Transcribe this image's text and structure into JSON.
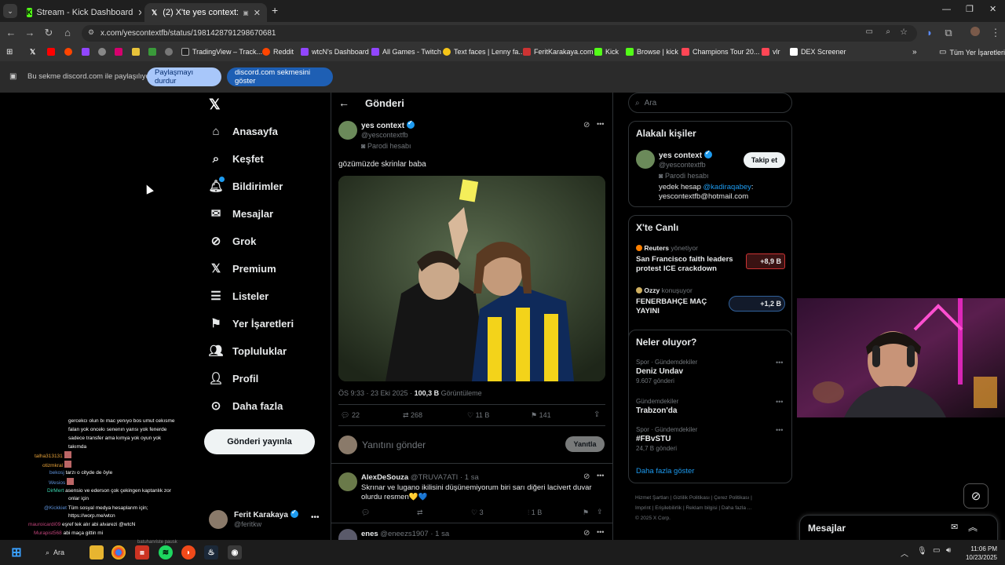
{
  "browser": {
    "tabs": [
      {
        "label": "Stream - Kick Dashboard",
        "icon": "kick-icon"
      },
      {
        "label": "(2) X'te yes context: \"gözüm",
        "icon": "x-icon"
      }
    ],
    "url": "x.com/yescontextfb/status/1981428791298670681",
    "bookmarks": [
      "TradingView – Track...",
      "Reddit",
      "wtcN's Dashboard",
      "All Games - Twitch",
      "Text faces | Lenny fa...",
      "FeritKarakaya.com",
      "Kick",
      "Browse | kick",
      "Champions Tour 20...",
      "vlr",
      "DEX Screener"
    ],
    "all_bookmarks": "Tüm Yer İşaretleri",
    "share": {
      "text": "Bu sekme discord.com ile paylaşılıyor",
      "stop": "Paylaşmayı durdur",
      "show": "discord.com sekmesini göster"
    }
  },
  "sidebar": {
    "items": [
      "Anasayfa",
      "Keşfet",
      "Bildirimler",
      "Mesajlar",
      "Grok",
      "Premium",
      "Listeler",
      "Yer İşaretleri",
      "Topluluklar",
      "Profil",
      "Daha fazla"
    ],
    "post_button": "Gönderi yayınla",
    "account": {
      "name": "Ferit Karakaya",
      "handle": "@feritkw"
    }
  },
  "main": {
    "header": "Gönderi",
    "post": {
      "author": "yes context",
      "handle": "@yescontextfb",
      "badge": "Parodi hesabı",
      "text": "gözümüzde skrinlar baba",
      "time": "ÖS 9:33 · 23 Eki 2025 ·",
      "views_count": "100,3 B",
      "views_label": "Görüntüleme",
      "stats": {
        "replies": "22",
        "reposts": "268",
        "likes": "11 B",
        "bookmarks": "141"
      }
    },
    "reply_placeholder": "Yanıtını gönder",
    "reply_button": "Yanıtla",
    "replies": [
      {
        "author": "AlexDeSouza",
        "handle": "@TRUVA7ATI",
        "time": "· 1 sa",
        "text": "Skrınar ve lugano ikilisini düşünemiyorum biri sarı diğeri lacivert duvar olurdu resmen💛💙",
        "likes": "3",
        "views": "1 B"
      },
      {
        "author": "enes",
        "handle": "@eneezs1907",
        "time": "· 1 sa"
      }
    ]
  },
  "right": {
    "search_placeholder": "Ara",
    "related": {
      "title": "Alakalı kişiler",
      "name": "yes context",
      "handle": "@yescontextfb",
      "badge": "Parodi hesabı",
      "follow": "Takip et",
      "bio_prefix": "yedek hesap",
      "bio_mention": "@kadiraqabey",
      "bio_suffix": ":",
      "bio_line2": "yescontextfb@hotmail.com"
    },
    "live": {
      "title": "X'te Canlı",
      "items": [
        {
          "host": "Reuters",
          "status": "yönetiyor",
          "title": "San Francisco faith leaders protest ICE crackdown",
          "count": "+8,9 B"
        },
        {
          "host": "Ozzy",
          "status": "konuşuyor",
          "title": "FENERBAHÇE MAÇ YAYINI",
          "count": "+1,2 B"
        }
      ]
    },
    "trends": {
      "title": "Neler oluyor?",
      "items": [
        {
          "category": "Spor · Gündemdekiler",
          "name": "Deniz Undav",
          "posts": "9.607 gönderi"
        },
        {
          "category": "Gündemdekiler",
          "name": "Trabzon'da",
          "posts": ""
        },
        {
          "category": "Spor · Gündemdekiler",
          "name": "#FBvSTU",
          "posts": "24,7 B gönderi"
        }
      ],
      "more": "Daha fazla göster"
    },
    "footer": [
      "Hizmet Şartları",
      "Gizlilik Politikası",
      "Çerez Politikası",
      "Imprint",
      "Erişilebilirlik",
      "Reklam bilgisi",
      "Daha fazla ...",
      "© 2025 X Corp."
    ],
    "messages": "Mesajlar"
  },
  "chat": [
    {
      "user": "",
      "text": "gercekcı olun bı mac yenıyo bos umut cekısme"
    },
    {
      "user": "",
      "text": "falan yok oncekı senenın yarısı yok fenerde"
    },
    {
      "user": "",
      "text": "sadece transfer ama kımya yok oyun yok"
    },
    {
      "user": "",
      "text": "takımda"
    },
    {
      "user": "talha313131",
      "text": ""
    },
    {
      "user": "otizmkral",
      "text": ""
    },
    {
      "user": "bekosj",
      "text": "tarzı o cityde de öyle"
    },
    {
      "user": "Wesios",
      "text": ""
    },
    {
      "user": "DirMert",
      "text": "asensio ve ederson çok çekingen kaptanlık zor"
    },
    {
      "user": "",
      "text": "onlar için"
    },
    {
      "user": "@Kickkiet",
      "text": "Tüm sosyal medya hesaplarım için;"
    },
    {
      "user": "",
      "text": "https://worp.me/wtcn"
    },
    {
      "user": "mauroicardi09",
      "text": "eşref tek alır abi alvarezi @wtcN"
    },
    {
      "user": "Murapist568",
      "text": "abi maça gittin mi"
    }
  ],
  "taskbar": {
    "search": "Ara",
    "time": "11:06 PM",
    "date": "10/23/2025",
    "tooltip": "batuhanriste pausk"
  }
}
